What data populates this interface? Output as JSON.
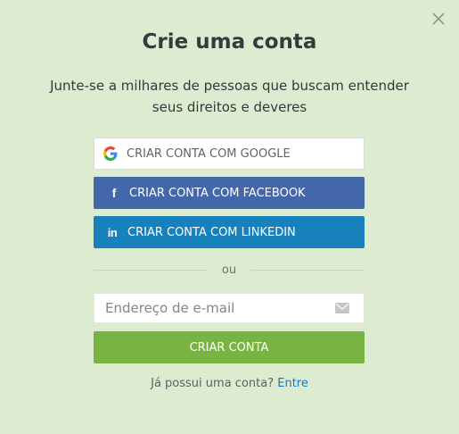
{
  "modal": {
    "title": "Crie uma conta",
    "subtitle": "Junte-se a milhares de pessoas que buscam entender seus direitos e deveres",
    "close_icon": "close-icon"
  },
  "social": {
    "google": {
      "label": "CRIAR CONTA COM GOOGLE",
      "icon": "google-icon"
    },
    "facebook": {
      "label": "CRIAR CONTA COM FACEBOOK",
      "icon": "facebook-icon",
      "color": "#4367aa",
      "icon_glyph": "f"
    },
    "linkedin": {
      "label": "CRIAR CONTA COM LINKEDIN",
      "icon": "linkedin-icon",
      "color": "#1781bd",
      "icon_glyph": "in"
    }
  },
  "divider": {
    "text": "ou"
  },
  "email": {
    "placeholder": "Endereço de e-mail",
    "value": "",
    "icon": "envelope-icon"
  },
  "create_button": {
    "label": "CRIAR CONTA",
    "color": "#79b443"
  },
  "login": {
    "prompt": "Já possui uma conta?",
    "link_label": "Entre"
  },
  "colors": {
    "background": "#ddebd0",
    "link": "#1a78c2"
  }
}
